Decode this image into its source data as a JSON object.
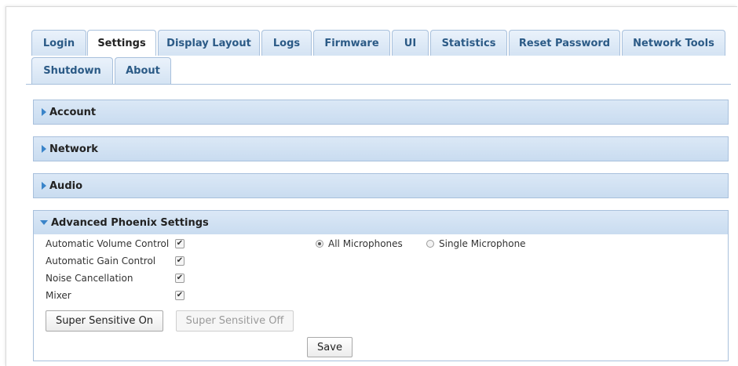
{
  "tabs": [
    "Login",
    "Settings",
    "Display Layout",
    "Logs",
    "Firmware",
    "UI",
    "Statistics",
    "Reset Password",
    "Network Tools",
    "Shutdown",
    "About"
  ],
  "active_tab": "Settings",
  "sections": {
    "account": "Account",
    "network": "Network",
    "audio": "Audio",
    "advanced": "Advanced Phoenix Settings"
  },
  "advanced": {
    "rows": [
      {
        "label": "Automatic Volume Control",
        "checked": true
      },
      {
        "label": "Automatic Gain Control",
        "checked": true
      },
      {
        "label": "Noise Cancellation",
        "checked": true
      },
      {
        "label": "Mixer",
        "checked": true
      }
    ],
    "radio_all": "All Microphones",
    "radio_single": "Single Microphone",
    "radio_selected": "All Microphones",
    "btn_sensitive_on": "Super Sensitive On",
    "btn_sensitive_off": "Super Sensitive Off",
    "btn_save": "Save"
  },
  "colors": {
    "accent": "#3a84c9",
    "header_bg": "#c9dcf0",
    "border": "#a8c0dc",
    "tab_text": "#2b5a86"
  }
}
